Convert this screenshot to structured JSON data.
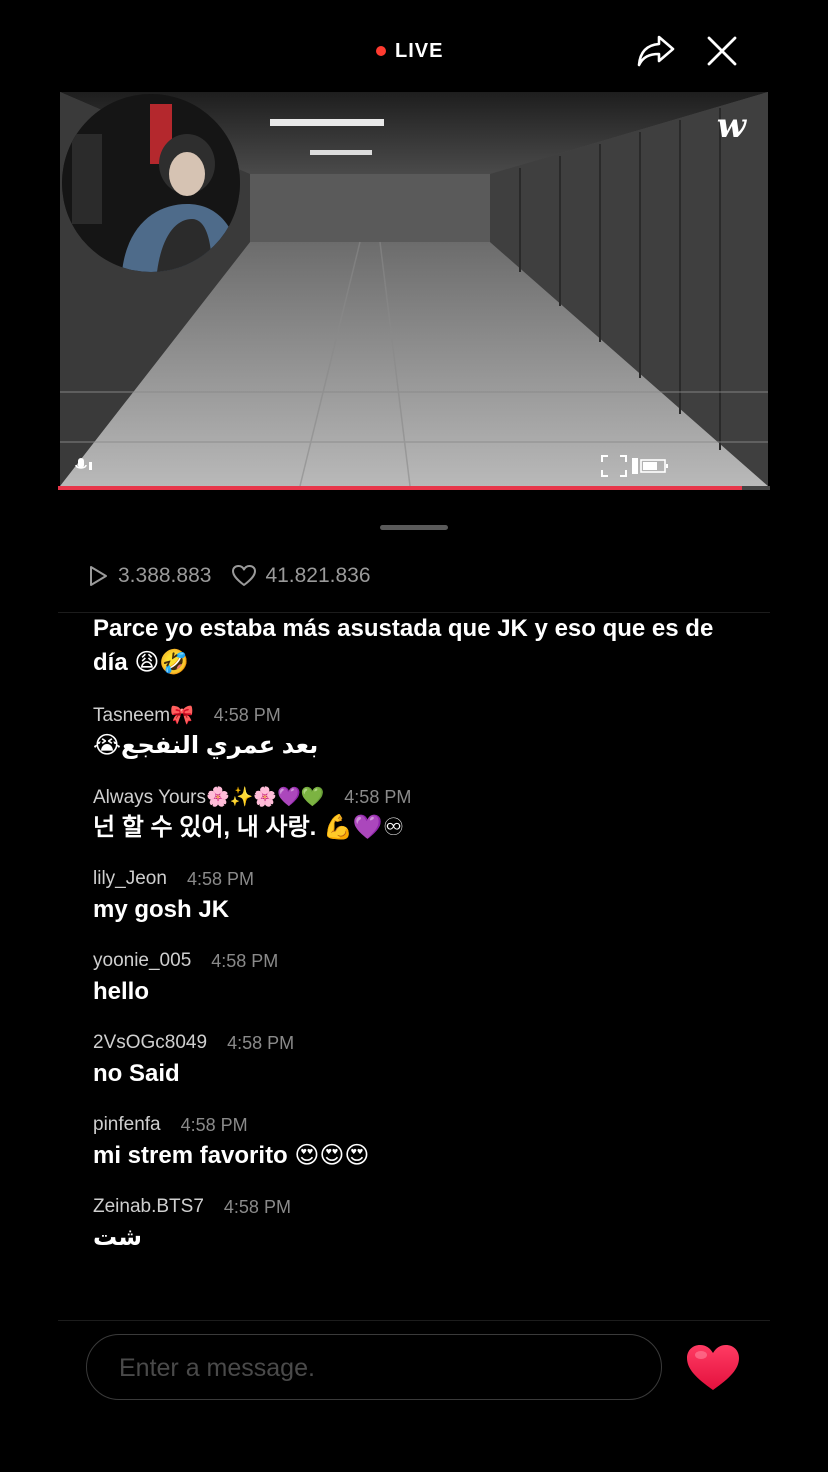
{
  "header": {
    "live_label": "LIVE",
    "colors": {
      "live_dot": "#ff3b30",
      "accent": "#e8364a"
    }
  },
  "video": {
    "logo_text": "w",
    "progress_fraction": 0.96
  },
  "stats": {
    "plays": "3.388.883",
    "likes": "41.821.836"
  },
  "chat": {
    "first_message": "Parce yo estaba más asustada que JK y eso que es de día 😩🤣",
    "messages": [
      {
        "user": "Tasneem🎀",
        "time": "4:58 PM",
        "text": "بعد عمري النفجع😭"
      },
      {
        "user": "Always Yours🌸✨🌸💜💚",
        "time": "4:58 PM",
        "text": "넌 할 수 있어, 내 사랑. 💪💜♾"
      },
      {
        "user": "lily_Jeon",
        "time": "4:58 PM",
        "text": "my gosh JK"
      },
      {
        "user": "yoonie_005",
        "time": "4:58 PM",
        "text": "hello"
      },
      {
        "user": "2VsOGc8049",
        "time": "4:58 PM",
        "text": "no Said"
      },
      {
        "user": "pinfenfa",
        "time": "4:58 PM",
        "text": "mi strem favorito 😍😍😍"
      },
      {
        "user": "Zeinab.BTS7",
        "time": "4:58 PM",
        "text": "شت"
      }
    ]
  },
  "composer": {
    "placeholder": "Enter a message.",
    "value": ""
  },
  "icons": {
    "share": "share-arrow-icon",
    "close": "close-icon",
    "play": "play-icon",
    "like": "heart-outline-icon",
    "send_heart": "heart-filled-icon"
  }
}
